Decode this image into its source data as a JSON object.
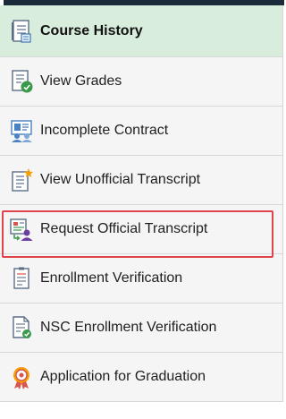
{
  "nav": {
    "items": [
      {
        "label": "Course History",
        "icon": "course-history-icon",
        "active": true
      },
      {
        "label": "View Grades",
        "icon": "view-grades-icon",
        "active": false
      },
      {
        "label": "Incomplete Contract",
        "icon": "incomplete-contract-icon",
        "active": false
      },
      {
        "label": "View Unofficial Transcript",
        "icon": "unofficial-transcript-icon",
        "active": false
      },
      {
        "label": "Request Official Transcript",
        "icon": "request-transcript-icon",
        "active": false,
        "highlighted": true
      },
      {
        "label": "Enrollment Verification",
        "icon": "enrollment-verification-icon",
        "active": false
      },
      {
        "label": "NSC Enrollment Verification",
        "icon": "nsc-verification-icon",
        "active": false
      },
      {
        "label": "Application for Graduation",
        "icon": "graduation-application-icon",
        "active": false
      }
    ]
  },
  "colors": {
    "active_bg": "#d9eddd",
    "item_bg": "#f5f5f5",
    "highlight_border": "#e0454b",
    "accent_green": "#3a9a4c",
    "accent_orange": "#f5a000",
    "accent_purple": "#6b3fa0"
  }
}
